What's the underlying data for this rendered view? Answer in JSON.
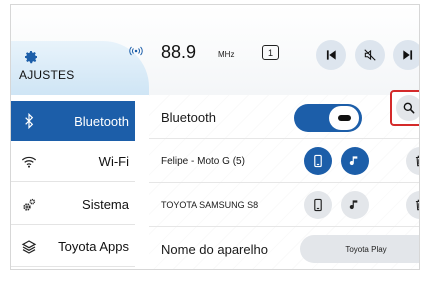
{
  "header": {
    "settings_label": "AJUSTES",
    "frequency": "88.9",
    "band": "MHz",
    "preset": "1",
    "buttons": [
      "previous-track",
      "mute",
      "next-track"
    ]
  },
  "sidebar": {
    "items": [
      {
        "label": "Bluetooth",
        "icon": "bluetooth-icon",
        "active": true
      },
      {
        "label": "Wi-Fi",
        "icon": "wifi-icon",
        "active": false
      },
      {
        "label": "Sistema",
        "icon": "gears-icon",
        "active": false
      },
      {
        "label": "Toyota Apps",
        "icon": "toyota-apps-icon",
        "active": false
      }
    ]
  },
  "bluetooth": {
    "label": "Bluetooth",
    "enabled": true
  },
  "devices": [
    {
      "name": "Felipe - Moto G (5)",
      "phone_active": true,
      "media_active": true
    },
    {
      "name": "TOYOTA SAMSUNG S8",
      "phone_active": false,
      "media_active": false
    }
  ],
  "device_name": {
    "label": "Nome do aparelho",
    "value": "Toyota Play"
  },
  "colors": {
    "accent": "#1c5ea9",
    "highlight": "#d42a2a",
    "button_bg": "#e3e6ea"
  }
}
